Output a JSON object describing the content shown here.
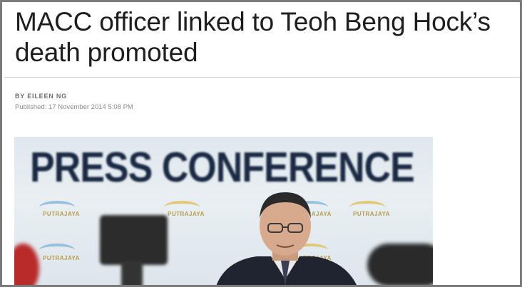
{
  "article": {
    "headline": "MACC officer linked to Teoh Beng Hock’s death promoted",
    "byline": "BY EILEEN NG",
    "published": "Published: 17 November 2014 5:08 PM"
  },
  "photo": {
    "banner_text": "PRESS CONFERENCE",
    "backdrop_logo_text": "PUTRAJAYA"
  }
}
